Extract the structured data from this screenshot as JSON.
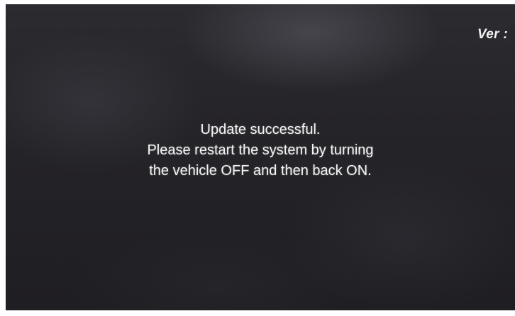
{
  "screen": {
    "version_label": "Ver :",
    "message": {
      "line1": "Update successful.",
      "line2": "Please restart the system by turning",
      "line3": "the vehicle OFF and then back ON."
    }
  }
}
